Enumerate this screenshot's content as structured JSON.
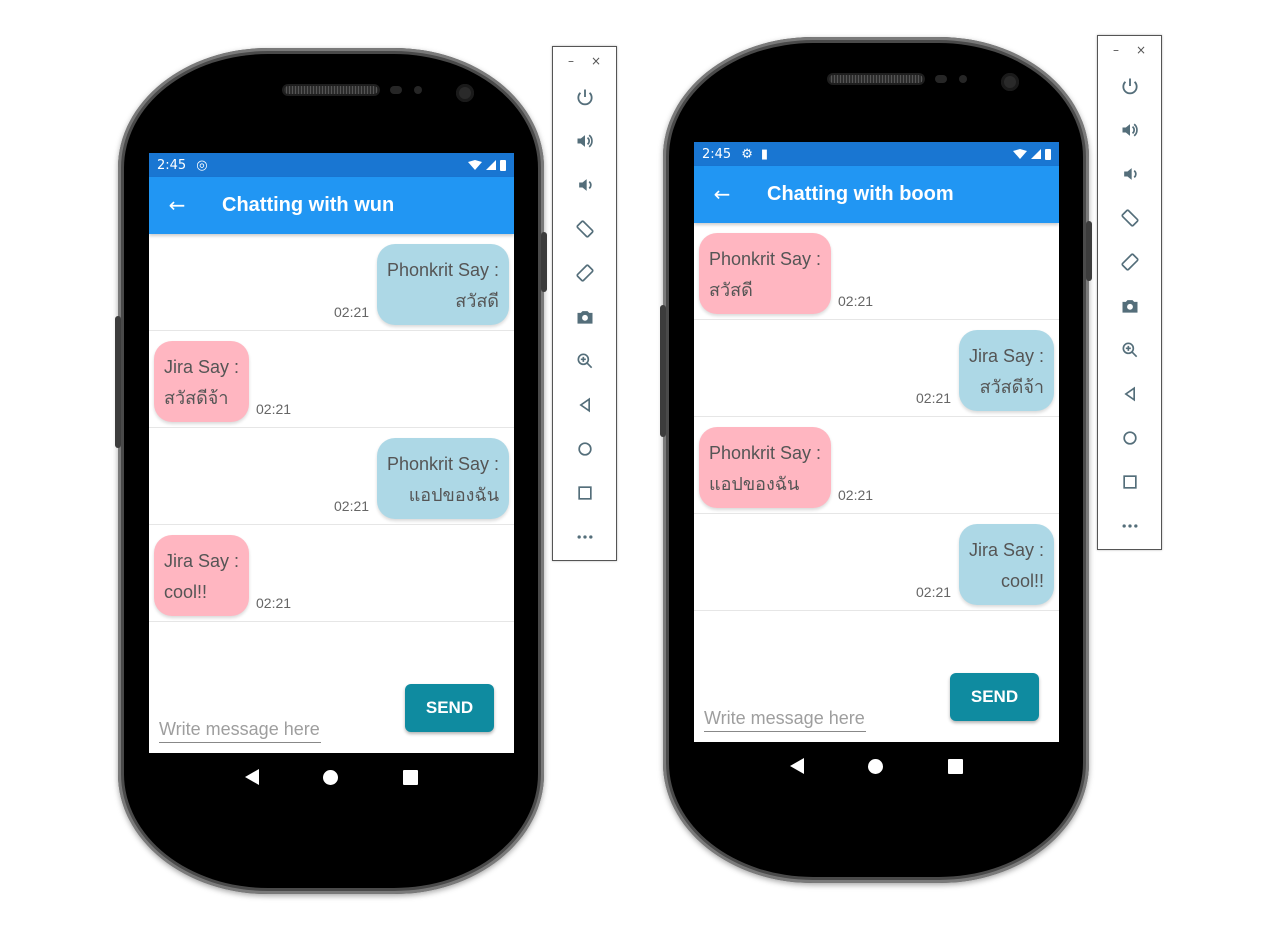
{
  "phones": [
    {
      "status_time": "2:45",
      "chat_title": "Chatting with wun",
      "messages": [
        {
          "side": "me",
          "sender": "Phonkrit Say :",
          "text": "สวัสดี",
          "time": "02:21"
        },
        {
          "side": "them",
          "sender": "Jira Say :",
          "text": "สวัสดีจ้า",
          "time": "02:21"
        },
        {
          "side": "me",
          "sender": "Phonkrit Say :",
          "text": "แอปของฉัน",
          "time": "02:21"
        },
        {
          "side": "them",
          "sender": "Jira Say :",
          "text": "cool!!",
          "time": "02:21"
        }
      ],
      "input_placeholder": "Write message here",
      "send_label": "SEND"
    },
    {
      "status_time": "2:45",
      "chat_title": "Chatting with boom",
      "messages": [
        {
          "side": "them",
          "sender": "Phonkrit Say :",
          "text": "สวัสดี",
          "time": "02:21"
        },
        {
          "side": "me",
          "sender": "Jira Say :",
          "text": "สวัสดีจ้า",
          "time": "02:21"
        },
        {
          "side": "them",
          "sender": "Phonkrit Say :",
          "text": "แอปของฉัน",
          "time": "02:21"
        },
        {
          "side": "me",
          "sender": "Jira Say :",
          "text": "cool!!",
          "time": "02:21"
        }
      ],
      "input_placeholder": "Write message here",
      "send_label": "SEND"
    }
  ],
  "toolbar": {
    "minimize_label": "–",
    "close_label": "×",
    "items": [
      "power-icon",
      "volume-up-icon",
      "volume-down-icon",
      "rotate-left-icon",
      "rotate-right-icon",
      "camera-icon",
      "zoom-icon",
      "back-icon",
      "home-icon",
      "overview-icon",
      "more-icon"
    ]
  },
  "colors": {
    "status_bar": "#1976d2",
    "app_bar": "#2196f3",
    "bubble_me": "#add8e6",
    "bubble_them": "#ffb6c1",
    "send_button": "#0f8ba0"
  }
}
